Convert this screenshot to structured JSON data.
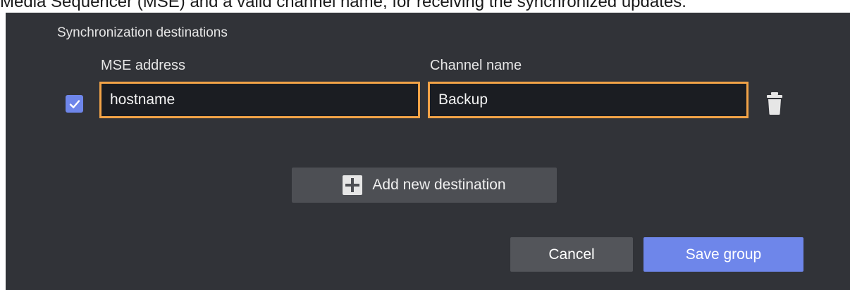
{
  "caption": "Media Sequencer (MSE) and a valid channel name, for receiving the synchronized updates.",
  "dialog": {
    "section_label": "Synchronization destinations",
    "columns": {
      "mse_address": "MSE address",
      "channel_name": "Channel name"
    },
    "destinations": [
      {
        "enabled": true,
        "mse_address": "hostname",
        "channel_name": "Backup"
      }
    ],
    "add_label": "Add new destination",
    "cancel_label": "Cancel",
    "save_label": "Save group"
  },
  "colors": {
    "background": "#313338",
    "accent": "#6e86ea",
    "field_border": "#f2a347"
  },
  "icons": [
    "check-icon",
    "trash-icon",
    "plus-icon"
  ]
}
